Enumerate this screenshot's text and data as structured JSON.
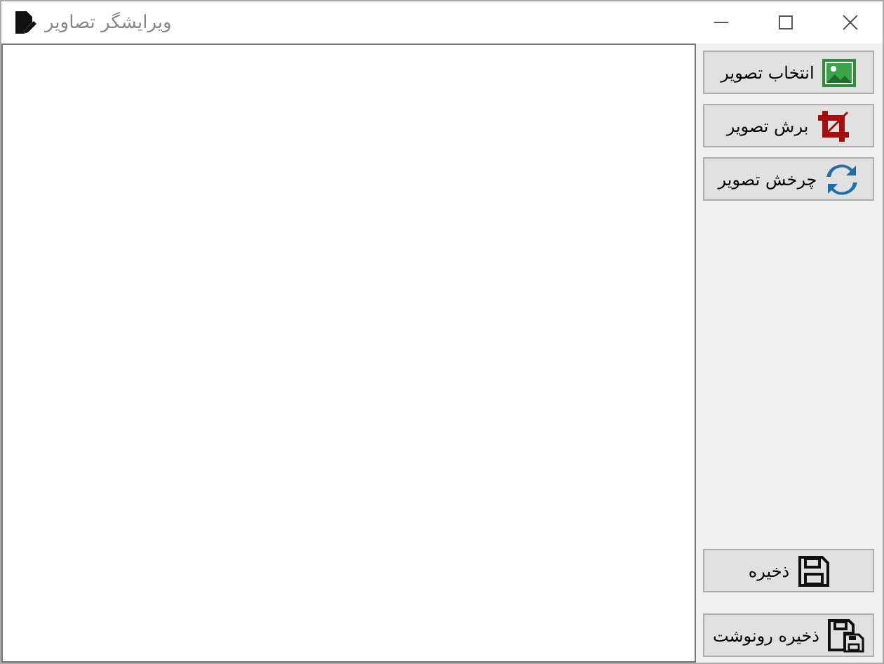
{
  "window": {
    "title": "ویرایشگر تصاویر"
  },
  "top_buttons": [
    {
      "label": "انتخاب تصویر",
      "kind": "image"
    },
    {
      "label": "برش تصویر",
      "kind": "crop"
    },
    {
      "label": "چرخش تصویر",
      "kind": "rotate"
    }
  ],
  "bottom_buttons": [
    {
      "label": "ذخیره",
      "kind": "save"
    },
    {
      "label": "ذخیره رونوشت",
      "kind": "saveas"
    }
  ]
}
